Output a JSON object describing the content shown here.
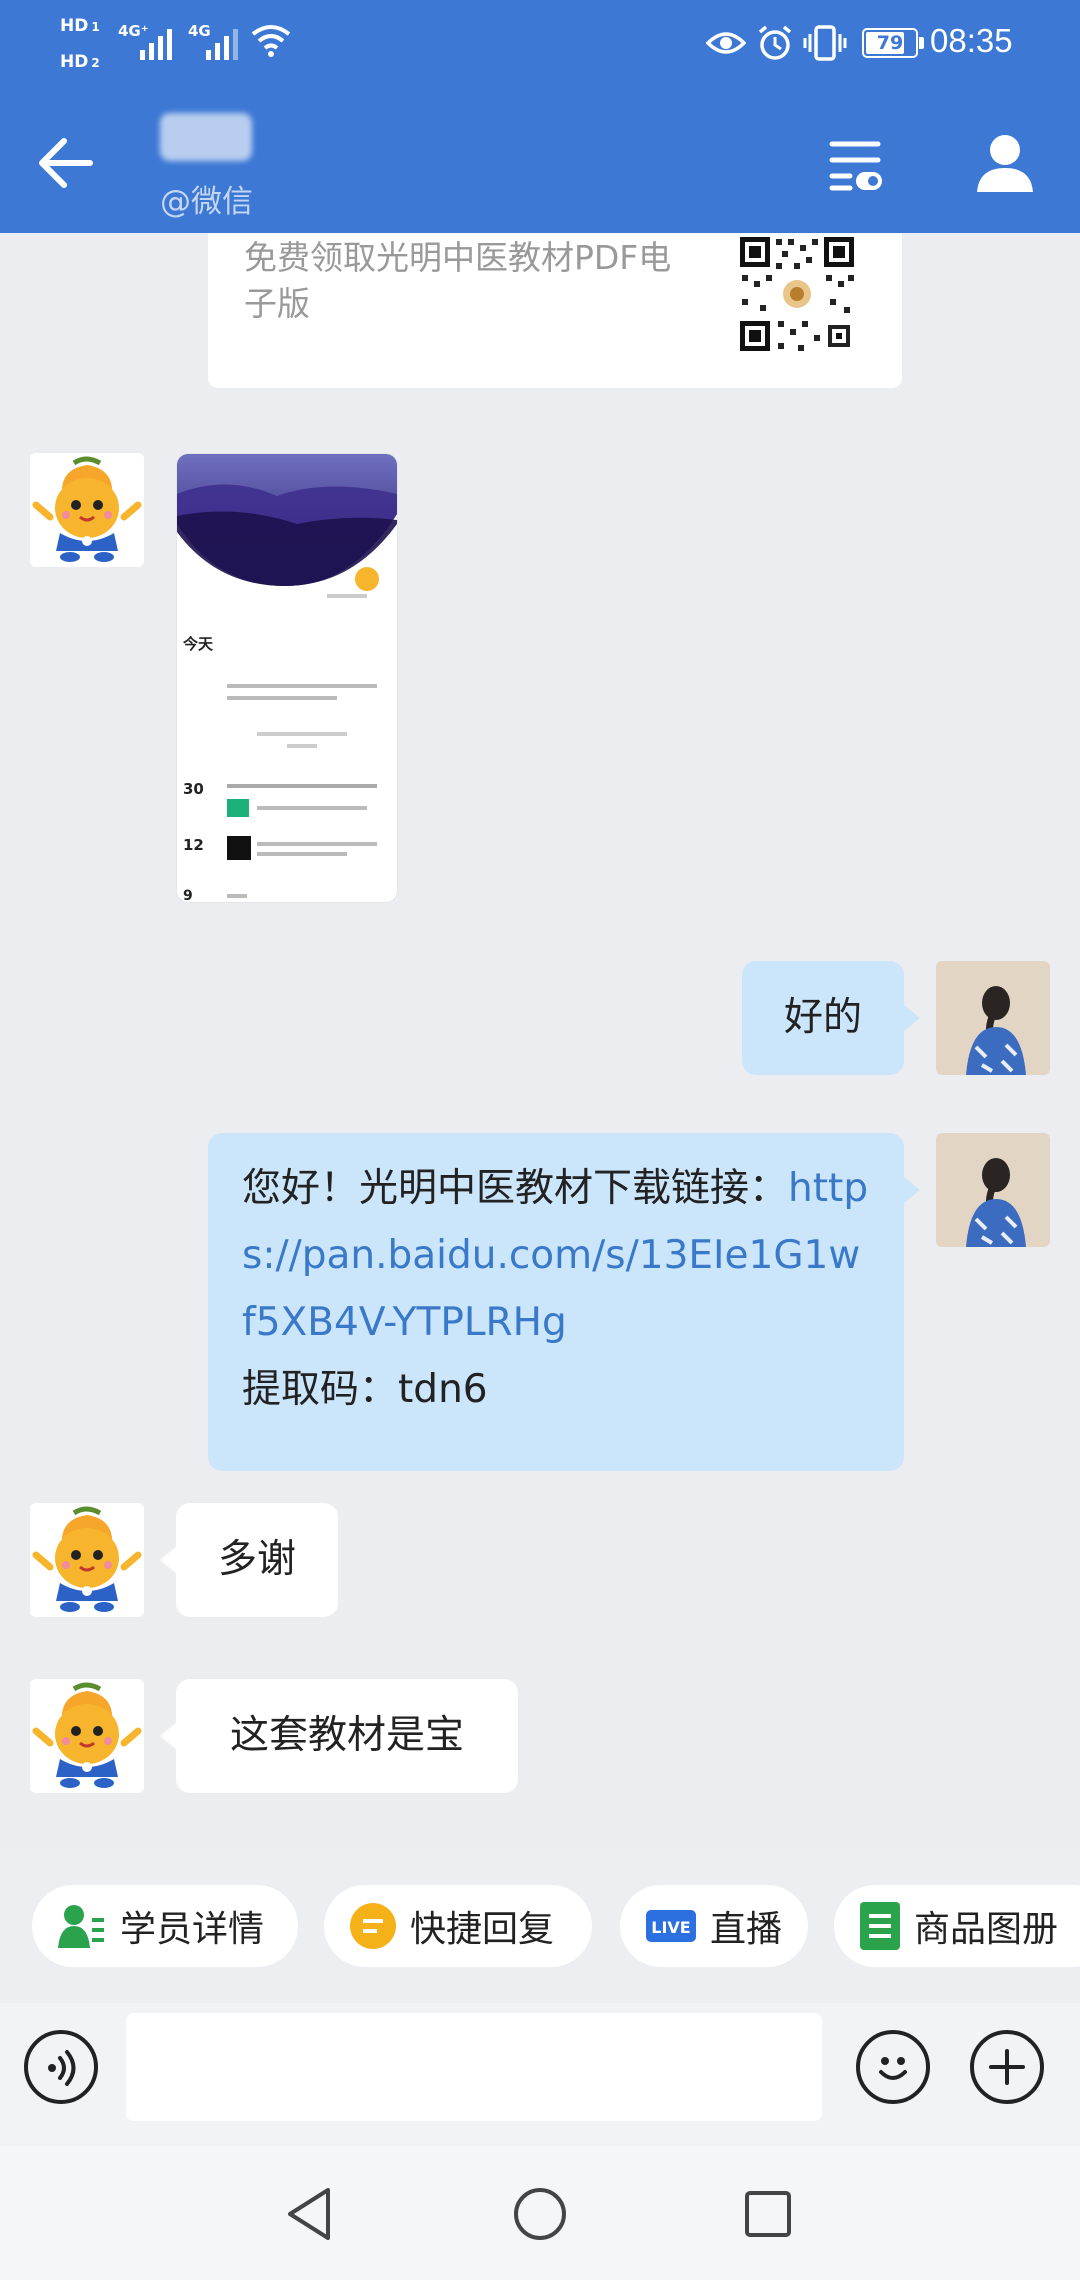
{
  "status_bar": {
    "hd1": "HD",
    "hd1_sub": "1",
    "hd2": "HD",
    "hd2_sub": "2",
    "net1": "4G⁺",
    "net2": "4G",
    "battery": 79,
    "time": "08:35"
  },
  "header": {
    "contact_source": "@微信"
  },
  "messages": {
    "card_text": "免费领取光明中医教材PDF电子版",
    "reply_ok": "好的",
    "link_prefix": "您好！光明中医教材下载链接：",
    "link_url": "https://pan.baidu.com/s/13EIe1G1wf5XB4V-YTPLRHg",
    "code_label": "提取码：",
    "code_value": "tdn6",
    "thanks": "多谢",
    "treasure": "这套教材是宝"
  },
  "quick_actions": [
    {
      "label": "学员详情",
      "icon": "student-details-icon",
      "color": "#2ba24c"
    },
    {
      "label": "快捷回复",
      "icon": "quick-reply-icon",
      "color": "#f4b218"
    },
    {
      "label": "直播",
      "icon": "live-icon",
      "badge": "LIVE",
      "color": "#2c6fe0"
    },
    {
      "label": "商品图册",
      "icon": "product-album-icon",
      "color": "#2ba24c"
    }
  ],
  "input": {
    "placeholder": ""
  },
  "colors": {
    "header_bg": "#3d78d5",
    "outgoing_bubble": "#cbe5fb",
    "link": "#3a78c8"
  }
}
